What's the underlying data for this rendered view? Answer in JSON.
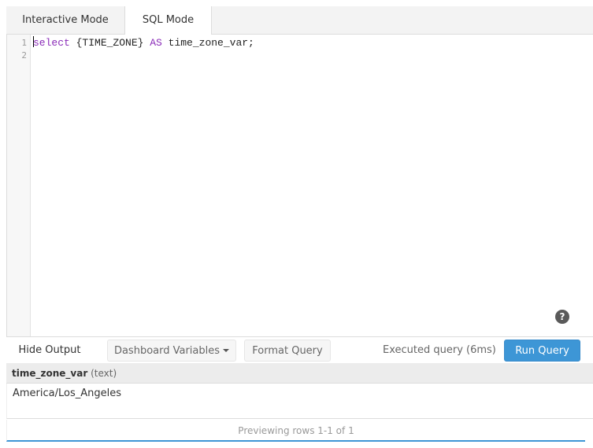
{
  "tabs": [
    {
      "label": "Interactive Mode",
      "active": false
    },
    {
      "label": "SQL Mode",
      "active": true
    }
  ],
  "editor": {
    "line_numbers": [
      "1",
      "2"
    ],
    "code": {
      "kw1": "select",
      "mid1": " {TIME_ZONE} ",
      "kw2": "AS",
      "rest": " time_zone_var;"
    },
    "help_icon": "question-circle-icon"
  },
  "toolbar": {
    "hide_output": "Hide Output",
    "dashboard_variables": "Dashboard Variables",
    "format_query": "Format Query",
    "status": "Executed query (6ms)",
    "run_query": "Run Query",
    "accent_color": "#3d96d6"
  },
  "results": {
    "columns": [
      {
        "name": "time_zone_var",
        "type": "(text)"
      }
    ],
    "rows": [
      [
        "America/Los_Angeles"
      ]
    ],
    "footer": "Previewing rows 1-1 of 1"
  }
}
